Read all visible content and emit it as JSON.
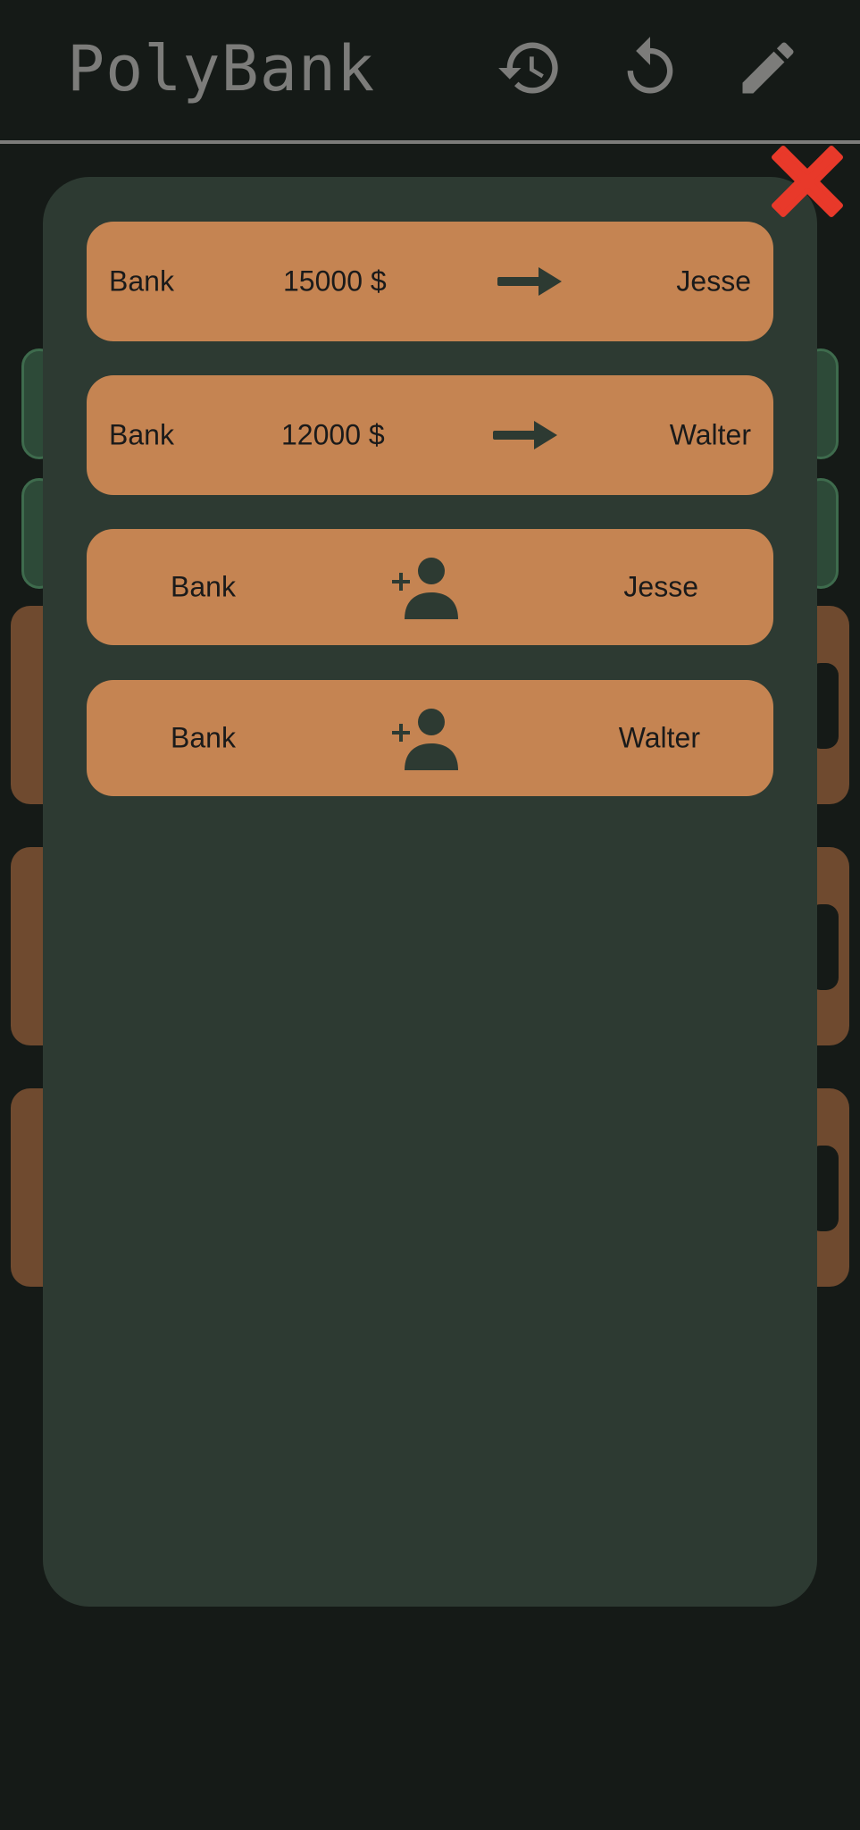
{
  "header": {
    "title": "PolyBank",
    "icons": [
      "history-icon",
      "undo-icon",
      "edit-icon"
    ]
  },
  "modal": {
    "close_icon": "close-icon",
    "entries": [
      {
        "kind": "transfer",
        "from": "Bank",
        "amount": "15000 $",
        "to": "Jesse"
      },
      {
        "kind": "transfer",
        "from": "Bank",
        "amount": "12000 $",
        "to": "Walter"
      },
      {
        "kind": "add-player",
        "from": "Bank",
        "to": "Jesse"
      },
      {
        "kind": "add-player",
        "from": "Bank",
        "to": "Walter"
      }
    ]
  },
  "colors": {
    "background": "#151a17",
    "modal": "#2d3a32",
    "entry": "#c58452",
    "icon_dark": "#2d3a32",
    "title_gray": "#7c7c7a",
    "close_red": "#e8392a"
  }
}
